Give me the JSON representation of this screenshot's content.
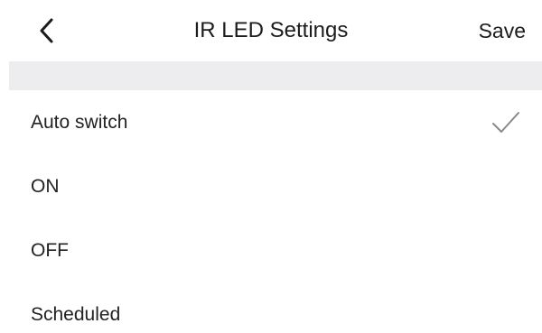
{
  "nav": {
    "back_icon": "chevron-left-icon",
    "title": "IR LED Settings",
    "save_label": "Save"
  },
  "options": [
    {
      "label": "Auto switch",
      "selected": true
    },
    {
      "label": "ON",
      "selected": false
    },
    {
      "label": "OFF",
      "selected": false
    },
    {
      "label": "Scheduled",
      "selected": false
    }
  ],
  "colors": {
    "divider_bg": "#ededf0",
    "check_color": "#8a8a8a",
    "text": "#1f1f1f"
  }
}
